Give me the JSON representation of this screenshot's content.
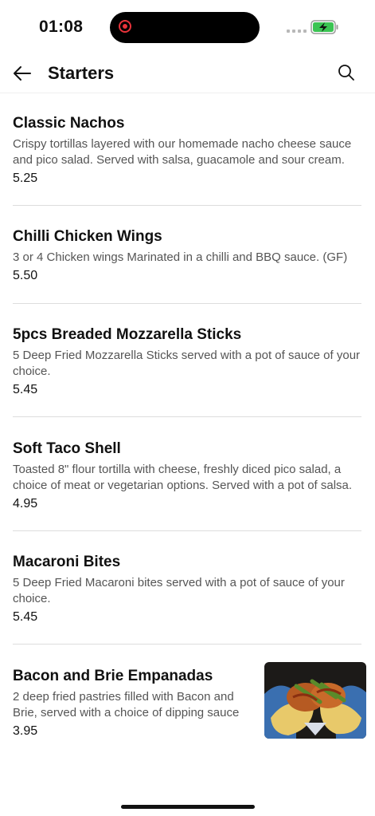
{
  "status_bar": {
    "time": "01:08"
  },
  "header": {
    "title": "Starters"
  },
  "items": [
    {
      "name": "Classic Nachos",
      "description": "Crispy tortillas layered with our homemade nacho cheese sauce and pico salad. Served with salsa, guacamole and sour cream.",
      "price": "5.25"
    },
    {
      "name": "Chilli Chicken Wings",
      "description": "3 or 4 Chicken wings Marinated in a chilli and BBQ sauce. (GF)",
      "price": "5.50"
    },
    {
      "name": "5pcs Breaded Mozzarella Sticks",
      "description": "5 Deep Fried Mozzarella Sticks served with a pot of sauce of your choice.",
      "price": "5.45"
    },
    {
      "name": "Soft Taco Shell",
      "description": "Toasted 8\" flour tortilla with cheese, freshly diced pico salad, a choice of meat or vegetarian options. Served with a pot of salsa.",
      "price": "4.95"
    },
    {
      "name": "Macaroni Bites",
      "description": "5 Deep Fried Macaroni bites served with a pot of sauce of your choice.",
      "price": "5.45"
    },
    {
      "name": "Bacon and Brie Empanadas",
      "description": "2 deep fried pastries filled with  Bacon and Brie, served with a choice of dipping sauce",
      "price": "3.95"
    }
  ],
  "colors": {
    "recording": "#e8333a",
    "battery": "#3bc453",
    "divider": "#dddddd"
  },
  "icons": [
    "back-arrow-icon",
    "search-icon",
    "battery-charging-icon",
    "recording-icon"
  ]
}
